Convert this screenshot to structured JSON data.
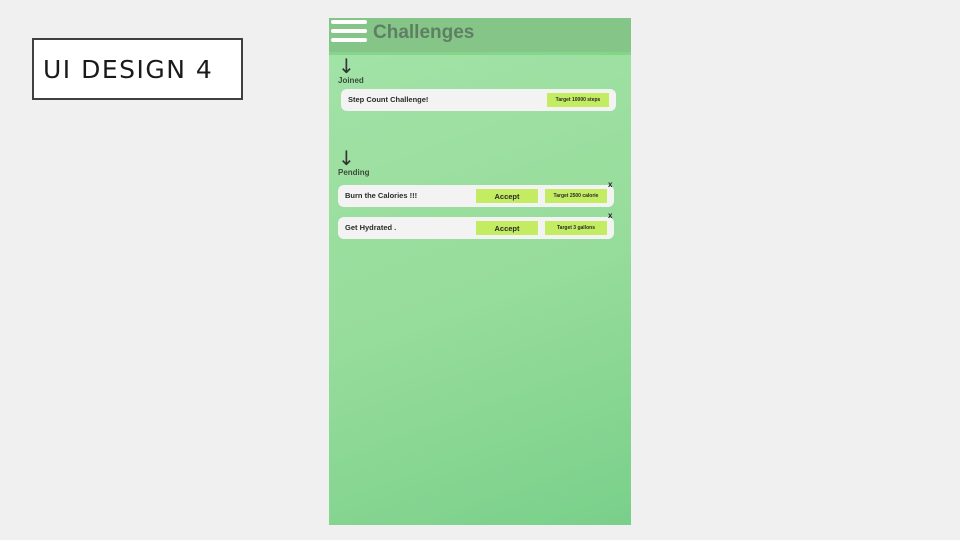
{
  "slide": {
    "title": "UI DESIGN 4"
  },
  "app": {
    "title": "Challenges",
    "menu_icon": "hamburger-menu-icon",
    "accent_color": "#c4ec62"
  },
  "sections": {
    "joined": {
      "arrow": "↓",
      "label": "Joined",
      "items": [
        {
          "title": "Step Count Challenge!",
          "target": "Target 10000 steps"
        }
      ]
    },
    "pending": {
      "arrow": "↓",
      "label": "Pending",
      "items": [
        {
          "title": "Burn the Calories !!!",
          "accept": "Accept",
          "target": "Target 2500 calorie",
          "close": "x"
        },
        {
          "title": "Get Hydrated .",
          "accept": "Accept",
          "target": "Target 3 gallons",
          "close": "x"
        }
      ]
    }
  }
}
